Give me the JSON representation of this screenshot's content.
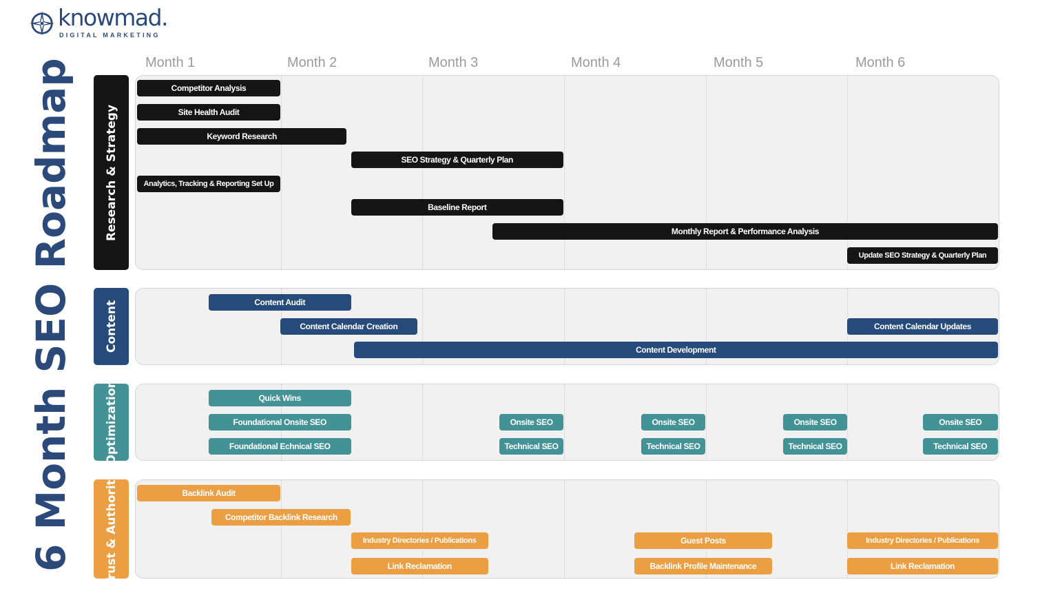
{
  "brand": {
    "name": "knowmad.",
    "tagline": "DIGITAL MARKETING",
    "logo_icon": "compass-icon",
    "color": "#2b4a7a"
  },
  "title": "6 Month SEO Roadmap",
  "months": [
    "Month 1",
    "Month 2",
    "Month 3",
    "Month 4",
    "Month 5",
    "Month 6"
  ],
  "chart_data": {
    "type": "gantt",
    "title": "6 Month SEO Roadmap",
    "x_unit": "months",
    "xlim": [
      0,
      6
    ],
    "tick_labels": [
      "Month 1",
      "Month 2",
      "Month 3",
      "Month 4",
      "Month 5",
      "Month 6"
    ],
    "sections": [
      {
        "name": "Research & Strategy",
        "color": "#151515",
        "tasks": [
          {
            "label": "Competitor Analysis",
            "start": 0,
            "end": 1,
            "row": 0
          },
          {
            "label": "Site Health Audit",
            "start": 0,
            "end": 1,
            "row": 1
          },
          {
            "label": "Keyword Research",
            "start": 0,
            "end": 1.47,
            "row": 2
          },
          {
            "label": "SEO Strategy & Quarterly Plan",
            "start": 1.5,
            "end": 3.0,
            "row": 3
          },
          {
            "label": "Analytics, Tracking & Reporting Set Up",
            "start": 0,
            "end": 1,
            "row": 4
          },
          {
            "label": "Baseline Report",
            "start": 1.5,
            "end": 3.0,
            "row": 5
          },
          {
            "label": "Monthly Report & Performance Analysis",
            "start": 2.5,
            "end": 6.0,
            "row": 6
          },
          {
            "label": "Update SEO Strategy & Quarterly Plan",
            "start": 5.0,
            "end": 6.0,
            "row": 7
          }
        ]
      },
      {
        "name": "Content",
        "color": "#264b7b",
        "tasks": [
          {
            "label": "Content Audit",
            "start": 0.5,
            "end": 1.5,
            "row": 0
          },
          {
            "label": "Content Calendar Creation",
            "start": 1.0,
            "end": 1.97,
            "row": 1
          },
          {
            "label": "Content Calendar Updates",
            "start": 5.0,
            "end": 6.0,
            "row": 1
          },
          {
            "label": "Content Development",
            "start": 1.52,
            "end": 6.0,
            "row": 2
          }
        ]
      },
      {
        "name": "Optimization",
        "color": "#439396",
        "tasks": [
          {
            "label": "Quick Wins",
            "start": 0.5,
            "end": 1.5,
            "row": 0
          },
          {
            "label": "Foundational Onsite SEO",
            "start": 0.5,
            "end": 1.5,
            "row": 1
          },
          {
            "label": "Foundational Echnical SEO",
            "start": 0.5,
            "end": 1.5,
            "row": 2
          },
          {
            "label": "Onsite SEO",
            "start": 2.55,
            "end": 3.0,
            "row": 1
          },
          {
            "label": "Technical SEO",
            "start": 2.55,
            "end": 3.0,
            "row": 2
          },
          {
            "label": "Onsite SEO",
            "start": 3.55,
            "end": 4.0,
            "row": 1
          },
          {
            "label": "Technical SEO",
            "start": 3.55,
            "end": 4.0,
            "row": 2
          },
          {
            "label": "Onsite SEO",
            "start": 4.55,
            "end": 5.0,
            "row": 1
          },
          {
            "label": "Technical SEO",
            "start": 4.55,
            "end": 5.0,
            "row": 2
          },
          {
            "label": "Onsite SEO",
            "start": 5.5,
            "end": 6.0,
            "row": 1
          },
          {
            "label": "Technical SEO",
            "start": 5.5,
            "end": 6.0,
            "row": 2
          }
        ]
      },
      {
        "name": "Trust & Authority",
        "color": "#eb9f42",
        "tasks": [
          {
            "label": "Backlink Audit",
            "start": 0,
            "end": 1,
            "row": 0
          },
          {
            "label": "Competitor Backlink Research",
            "start": 0.52,
            "end": 1.5,
            "row": 1
          },
          {
            "label": "Industry Directories / Publications",
            "start": 1.5,
            "end": 2.47,
            "row": 2
          },
          {
            "label": "Link Reclamation",
            "start": 1.5,
            "end": 2.47,
            "row": 3
          },
          {
            "label": "Guest Posts",
            "start": 3.5,
            "end": 4.47,
            "row": 2
          },
          {
            "label": "Backlink Profile Maintenance",
            "start": 3.5,
            "end": 4.47,
            "row": 3
          },
          {
            "label": "Industry Directories / Publications",
            "start": 5.0,
            "end": 6.0,
            "row": 2
          },
          {
            "label": "Link Reclamation",
            "start": 5.0,
            "end": 6.0,
            "row": 3
          }
        ]
      }
    ]
  }
}
